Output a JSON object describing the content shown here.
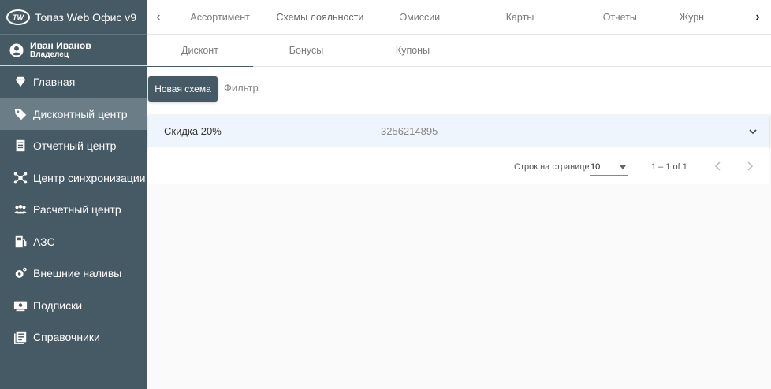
{
  "app": {
    "title": "Топаз Web Офис v9",
    "logo_text": "TW"
  },
  "user": {
    "name": "Иван Иванов",
    "role": "Владелец"
  },
  "sidebar": {
    "items": [
      {
        "label": "Главная",
        "icon": "diamond-icon"
      },
      {
        "label": "Дисконтный центр",
        "icon": "tag-icon"
      },
      {
        "label": "Отчетный центр",
        "icon": "report-icon"
      },
      {
        "label": "Центр синхронизации",
        "icon": "sync-hub-icon"
      },
      {
        "label": "Расчетный центр",
        "icon": "people-icon"
      },
      {
        "label": "АЗС",
        "icon": "gas-station-icon"
      },
      {
        "label": "Внешние наливы",
        "icon": "gear-icon"
      },
      {
        "label": "Подписки",
        "icon": "subscription-icon"
      },
      {
        "label": "Справочники",
        "icon": "book-icon"
      }
    ]
  },
  "tabs": [
    {
      "label": "Ассортимент"
    },
    {
      "label": "Схемы лояльности"
    },
    {
      "label": "Эмиссии"
    },
    {
      "label": "Карты"
    },
    {
      "label": "Отчеты"
    },
    {
      "label": "Журн"
    }
  ],
  "subtabs": [
    {
      "label": "Дисконт"
    },
    {
      "label": "Бонусы"
    },
    {
      "label": "Купоны"
    }
  ],
  "toolbar": {
    "new_button": "Новая схема",
    "filter_placeholder": "Фильтр"
  },
  "table": {
    "rows": [
      {
        "name": "Скидка 20%",
        "code": "3256214895"
      }
    ]
  },
  "pagination": {
    "rows_per_page_label": "Строк на странице",
    "rows_per_page": "10",
    "range": "1 – 1 of 1"
  },
  "colors": {
    "sidebar": "#455a64",
    "sidebar_active": "#6b7e88",
    "row_bg": "#eef5fc"
  }
}
